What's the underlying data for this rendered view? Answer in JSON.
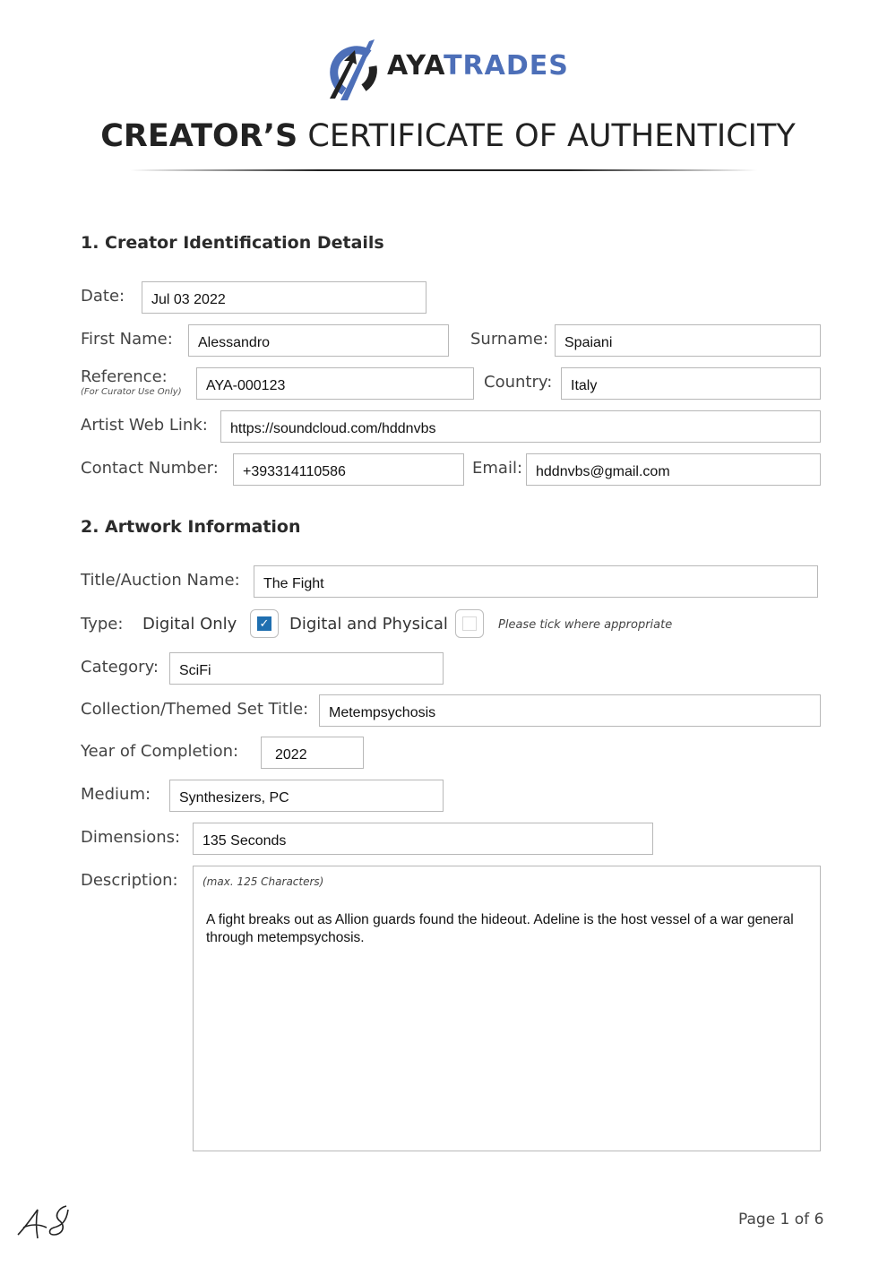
{
  "brand": {
    "name_dark": "AYA",
    "name_accent": "TRADES",
    "accent_color": "#4d6fb8"
  },
  "title": {
    "bold": "CREATOR’S",
    "light": "CERTIFICATE OF AUTHENTICITY"
  },
  "section1": {
    "heading": "1. Creator Identification Details",
    "date": {
      "label": "Date:",
      "value": "Jul 03 2022"
    },
    "first_name": {
      "label": "First Name:",
      "value": "Alessandro"
    },
    "surname": {
      "label": "Surname:",
      "value": "Spaiani"
    },
    "reference": {
      "label": "Reference:",
      "sublabel": "(For Curator Use Only)",
      "value": "AYA-000123"
    },
    "country": {
      "label": "Country:",
      "value": "Italy"
    },
    "web_link": {
      "label": "Artist Web Link:",
      "value": "https://soundcloud.com/hddnvbs"
    },
    "contact": {
      "label": "Contact Number:",
      "value": "+393314110586"
    },
    "email": {
      "label": "Email:",
      "value": "hddnvbs@gmail.com"
    }
  },
  "section2": {
    "heading": "2. Artwork Information",
    "title": {
      "label": "Title/Auction Name:",
      "value": "The Fight"
    },
    "type": {
      "label": "Type:",
      "options": [
        {
          "label": "Digital Only",
          "checked": true
        },
        {
          "label": "Digital and Physical",
          "checked": false
        }
      ],
      "hint": "Please tick where appropriate"
    },
    "category": {
      "label": "Category:",
      "value": "SciFi"
    },
    "collection": {
      "label": "Collection/Themed Set Title:",
      "value": "Metempsychosis"
    },
    "year": {
      "label": "Year of Completion:",
      "value": "2022"
    },
    "medium": {
      "label": "Medium:",
      "value": "Synthesizers, PC"
    },
    "dimensions": {
      "label": "Dimensions:",
      "value": "135 Seconds"
    },
    "description": {
      "label": "Description:",
      "limit": "(max. 125 Characters)",
      "value": "A fight breaks out as Allion guards found the hideout. Adeline is the host vessel of a war general through metempsychosis."
    }
  },
  "footer": {
    "signature": "AS",
    "page": "Page 1 of 6"
  }
}
